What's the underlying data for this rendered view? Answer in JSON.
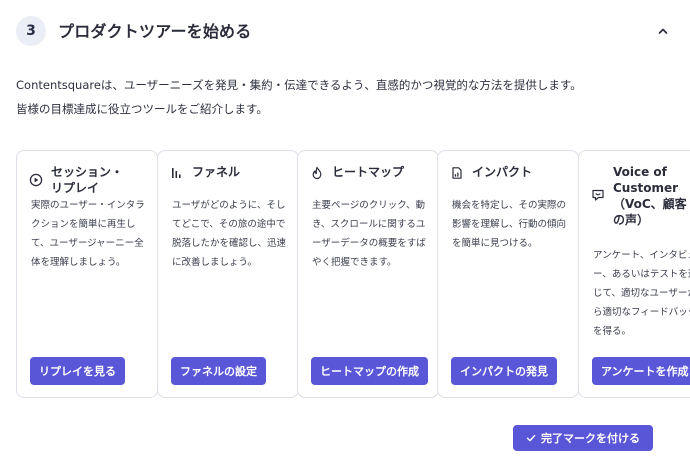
{
  "header": {
    "step_number": "3",
    "title": "プロダクトツアーを始める",
    "collapse_icon": "chevron-up-icon"
  },
  "description": {
    "line1": "Contentsquareは、ユーザーニーズを発見・集約・伝達できるよう、直感的かつ視覚的な方法を提供します。",
    "line2": "皆様の目標達成に役立つツールをご紹介します。"
  },
  "cards": [
    {
      "icon": "play-circle-icon",
      "title": "セッション・\nリプレイ",
      "description": "実際のユーザー・インタラクションを簡単に再生して、ユーザージャーニー全体を理解しましょう。",
      "button": "リプレイを見る"
    },
    {
      "icon": "funnel-bars-icon",
      "title": "ファネル",
      "description": "ユーザがどのように、そしてどこで、その旅の途中で脱落したかを確認し、迅速に改善しましょう。",
      "button": "ファネルの設定"
    },
    {
      "icon": "flame-icon",
      "title": "ヒートマップ",
      "description": "主要ページのクリック、動き、スクロールに関するユーザーデータの概要をすばやく把握できます。",
      "button": "ヒートマップの作成"
    },
    {
      "icon": "impact-chart-icon",
      "title": "インパクト",
      "description": "機会を特定し、その実際の影響を理解し、行動の傾向を簡単に見つける。",
      "button": "インパクトの発見"
    },
    {
      "icon": "feedback-smile-icon",
      "title": "Voice of\nCustomer\n（VoC、顧客\nの声）",
      "description": "アンケート、インタビュー、あるいはテストを通じて、適切なユーザーから適切なフィードバックを得る。",
      "button": "アンケートを作成"
    }
  ],
  "footer": {
    "complete_button": "完了マークを付ける",
    "complete_icon": "check-icon"
  },
  "colors": {
    "accent": "#5a56d8",
    "step_badge_bg": "#eceef7",
    "card_border": "#dcdfe8"
  }
}
